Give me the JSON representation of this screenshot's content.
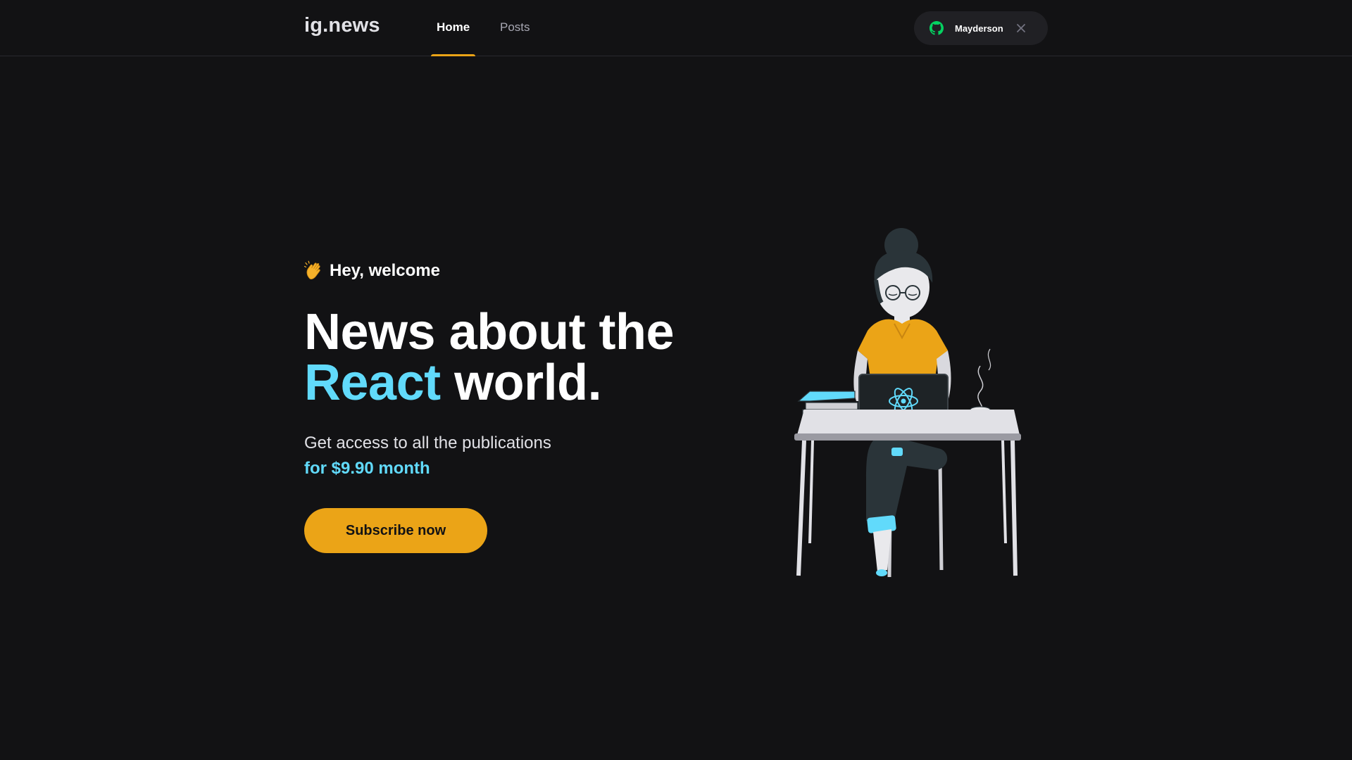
{
  "header": {
    "logo": "ig.news",
    "nav": [
      {
        "label": "Home",
        "active": true
      },
      {
        "label": "Posts",
        "active": false
      }
    ],
    "user": {
      "name": "Mayderson",
      "icon": "github-icon",
      "icon_color": "#04d361",
      "close_icon": "close-icon"
    }
  },
  "hero": {
    "welcome_emoji": "clapping-hand-icon",
    "welcome": "Hey, welcome",
    "headline_part1": "News about the",
    "headline_accent": "React",
    "headline_part2": " world.",
    "subtitle": "Get access to all the publications",
    "price": "for $9.90 month",
    "cta": "Subscribe now"
  },
  "colors": {
    "background": "#121214",
    "accent_cyan": "#61dafb",
    "accent_yellow": "#eba417",
    "button_dark": "#202024",
    "github_green": "#04d361"
  }
}
